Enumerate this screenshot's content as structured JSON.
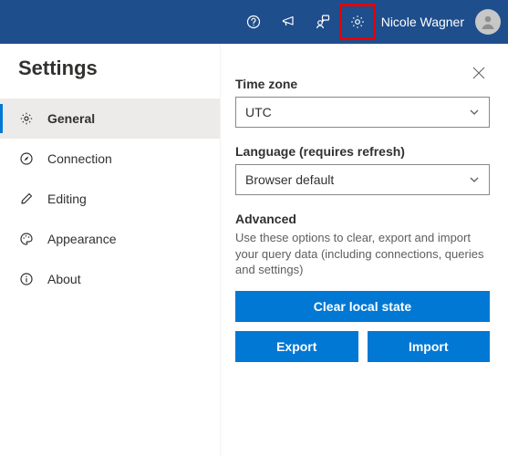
{
  "topbar": {
    "user_name": "Nicole Wagner"
  },
  "panel": {
    "title": "Settings"
  },
  "sidebar": {
    "items": [
      {
        "label": "General",
        "icon": "gear-icon",
        "active": true
      },
      {
        "label": "Connection",
        "icon": "compass-icon",
        "active": false
      },
      {
        "label": "Editing",
        "icon": "pencil-icon",
        "active": false
      },
      {
        "label": "Appearance",
        "icon": "palette-icon",
        "active": false
      },
      {
        "label": "About",
        "icon": "info-icon",
        "active": false
      }
    ]
  },
  "main": {
    "timezone_label": "Time zone",
    "timezone_value": "UTC",
    "language_label": "Language (requires refresh)",
    "language_value": "Browser default",
    "advanced_title": "Advanced",
    "advanced_desc": "Use these options to clear, export and import your query data (including connections, queries and settings)",
    "clear_button": "Clear local state",
    "export_button": "Export",
    "import_button": "Import"
  }
}
